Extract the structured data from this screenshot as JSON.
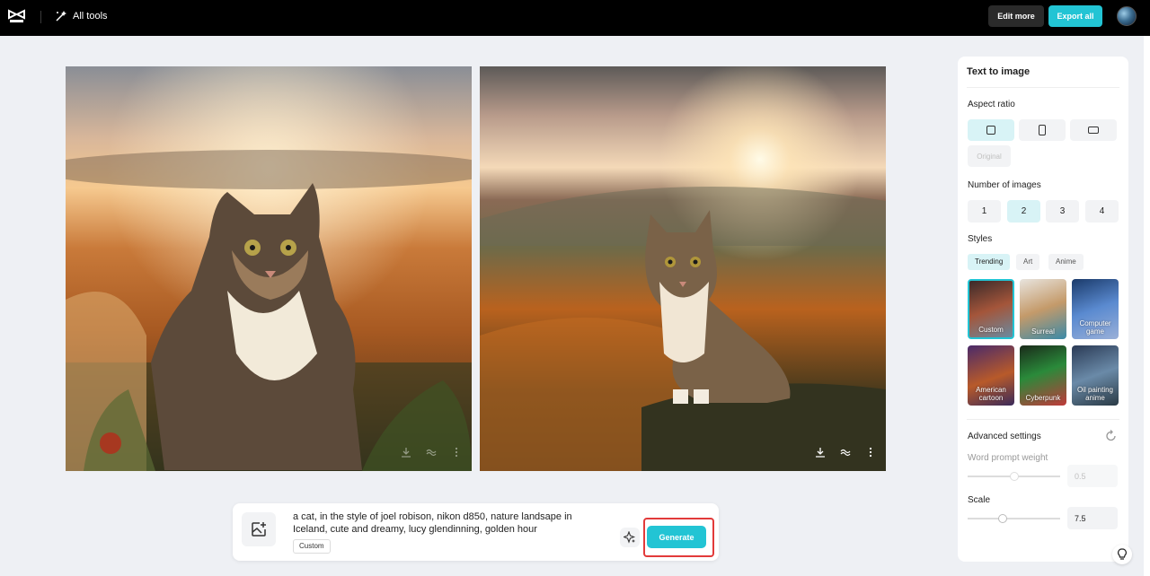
{
  "header": {
    "logo_icon": "capcut-logo-icon",
    "all_tools_label": "All tools",
    "edit_more_label": "Edit more",
    "export_all_label": "Export all",
    "accent_color": "#22c4d4"
  },
  "images": [
    {
      "actions": [
        "download-icon",
        "variation-icon",
        "more-icon"
      ]
    },
    {
      "actions": [
        "download-icon",
        "variation-icon",
        "more-icon"
      ]
    }
  ],
  "prompt": {
    "text": "a cat, in the style of joel robison, nikon d850, nature landsape in Iceland, cute and dreamy, lucy glendinning, golden hour",
    "tag": "Custom",
    "generate_label": "Generate"
  },
  "panel": {
    "title": "Text to image",
    "aspect_ratio_label": "Aspect ratio",
    "aspect_options": [
      "square",
      "portrait",
      "landscape"
    ],
    "aspect_selected": "square",
    "original_label": "Original",
    "num_images_label": "Number of images",
    "num_options": [
      "1",
      "2",
      "3",
      "4"
    ],
    "num_selected": "2",
    "styles_label": "Styles",
    "style_tabs": [
      "Trending",
      "Art",
      "Anime"
    ],
    "style_tab_selected": "Trending",
    "styles": [
      {
        "label": "Custom",
        "selected": true
      },
      {
        "label": "Surreal",
        "selected": false
      },
      {
        "label": "Computer game",
        "selected": false
      },
      {
        "label": "American cartoon",
        "selected": false
      },
      {
        "label": "Cyberpunk",
        "selected": false
      },
      {
        "label": "Oil painting anime",
        "selected": false
      }
    ],
    "advanced_label": "Advanced settings",
    "word_prompt_weight_label": "Word prompt weight",
    "word_prompt_weight_value": "0.5",
    "scale_label": "Scale",
    "scale_value": "7.5"
  }
}
